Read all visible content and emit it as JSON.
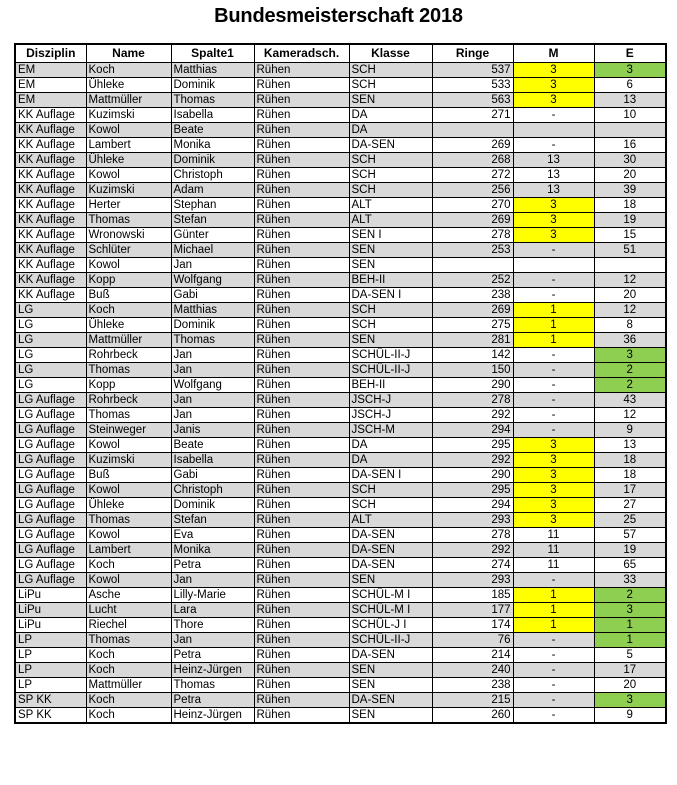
{
  "page": {
    "title": "Bundesmeisterschaft 2018",
    "colors": {
      "shaded_row": "#d9d9d9",
      "plain_row": "#ffffff",
      "highlight_yellow": "#ffff00",
      "highlight_green": "#8ece51",
      "border": "#000000",
      "text": "#000000"
    }
  },
  "table": {
    "columns": [
      "Disziplin",
      "Name",
      "Spalte1",
      "Kameradsch.",
      "Klasse",
      "Ringe",
      "M",
      "E"
    ],
    "rows": [
      {
        "disziplin": "EM",
        "name": "Koch",
        "spalte1": "Matthias",
        "kameradsch": "Rühen",
        "klasse": "SCH",
        "ringe": "537",
        "m": "3",
        "e": "3",
        "shaded": true,
        "m_hl": "yellow",
        "e_hl": "green"
      },
      {
        "disziplin": "EM",
        "name": "Ühleke",
        "spalte1": "Dominik",
        "kameradsch": "Rühen",
        "klasse": "SCH",
        "ringe": "533",
        "m": "3",
        "e": "6",
        "shaded": false,
        "m_hl": "yellow",
        "e_hl": ""
      },
      {
        "disziplin": "EM",
        "name": "Mattmüller",
        "spalte1": "Thomas",
        "kameradsch": "Rühen",
        "klasse": "SEN",
        "ringe": "563",
        "m": "3",
        "e": "13",
        "shaded": true,
        "m_hl": "yellow",
        "e_hl": ""
      },
      {
        "disziplin": "KK Auflage",
        "name": "Kuzimski",
        "spalte1": "Isabella",
        "kameradsch": "Rühen",
        "klasse": "DA",
        "ringe": "271",
        "m": "-",
        "e": "10",
        "shaded": false,
        "m_hl": "",
        "e_hl": ""
      },
      {
        "disziplin": "KK Auflage",
        "name": "Kowol",
        "spalte1": "Beate",
        "kameradsch": "Rühen",
        "klasse": "DA",
        "ringe": "",
        "m": "",
        "e": "",
        "shaded": true,
        "m_hl": "",
        "e_hl": ""
      },
      {
        "disziplin": "KK Auflage",
        "name": "Lambert",
        "spalte1": "Monika",
        "kameradsch": "Rühen",
        "klasse": "DA-SEN",
        "ringe": "269",
        "m": "-",
        "e": "16",
        "shaded": false,
        "m_hl": "",
        "e_hl": ""
      },
      {
        "disziplin": "KK Auflage",
        "name": "Ühleke",
        "spalte1": "Dominik",
        "kameradsch": "Rühen",
        "klasse": "SCH",
        "ringe": "268",
        "m": "13",
        "e": "30",
        "shaded": true,
        "m_hl": "",
        "e_hl": ""
      },
      {
        "disziplin": "KK Auflage",
        "name": "Kowol",
        "spalte1": "Christoph",
        "kameradsch": "Rühen",
        "klasse": "SCH",
        "ringe": "272",
        "m": "13",
        "e": "20",
        "shaded": false,
        "m_hl": "",
        "e_hl": ""
      },
      {
        "disziplin": "KK Auflage",
        "name": "Kuzimski",
        "spalte1": "Adam",
        "kameradsch": "Rühen",
        "klasse": "SCH",
        "ringe": "256",
        "m": "13",
        "e": "39",
        "shaded": true,
        "m_hl": "",
        "e_hl": ""
      },
      {
        "disziplin": "KK Auflage",
        "name": "Herter",
        "spalte1": "Stephan",
        "kameradsch": "Rühen",
        "klasse": "ALT",
        "ringe": "270",
        "m": "3",
        "e": "18",
        "shaded": false,
        "m_hl": "yellow",
        "e_hl": ""
      },
      {
        "disziplin": "KK Auflage",
        "name": "Thomas",
        "spalte1": "Stefan",
        "kameradsch": "Rühen",
        "klasse": "ALT",
        "ringe": "269",
        "m": "3",
        "e": "19",
        "shaded": true,
        "m_hl": "yellow",
        "e_hl": ""
      },
      {
        "disziplin": "KK Auflage",
        "name": "Wronowski",
        "spalte1": "Günter",
        "kameradsch": "Rühen",
        "klasse": "SEN I",
        "ringe": "278",
        "m": "3",
        "e": "15",
        "shaded": false,
        "m_hl": "yellow",
        "e_hl": ""
      },
      {
        "disziplin": "KK Auflage",
        "name": "Schlüter",
        "spalte1": "Michael",
        "kameradsch": "Rühen",
        "klasse": "SEN",
        "ringe": "253",
        "m": "-",
        "e": "51",
        "shaded": true,
        "m_hl": "",
        "e_hl": ""
      },
      {
        "disziplin": "KK Auflage",
        "name": "Kowol",
        "spalte1": "Jan",
        "kameradsch": "Rühen",
        "klasse": "SEN",
        "ringe": "",
        "m": "",
        "e": "",
        "shaded": false,
        "m_hl": "",
        "e_hl": ""
      },
      {
        "disziplin": "KK Auflage",
        "name": "Kopp",
        "spalte1": "Wolfgang",
        "kameradsch": "Rühen",
        "klasse": "BEH-II",
        "ringe": "252",
        "m": "-",
        "e": "12",
        "shaded": true,
        "m_hl": "",
        "e_hl": ""
      },
      {
        "disziplin": "KK Auflage",
        "name": "Buß",
        "spalte1": "Gabi",
        "kameradsch": "Rühen",
        "klasse": "DA-SEN I",
        "ringe": "238",
        "m": "-",
        "e": "20",
        "shaded": false,
        "m_hl": "",
        "e_hl": ""
      },
      {
        "disziplin": "LG",
        "name": "Koch",
        "spalte1": "Matthias",
        "kameradsch": "Rühen",
        "klasse": "SCH",
        "ringe": "269",
        "m": "1",
        "e": "12",
        "shaded": true,
        "m_hl": "yellow",
        "e_hl": ""
      },
      {
        "disziplin": "LG",
        "name": "Ühleke",
        "spalte1": "Dominik",
        "kameradsch": "Rühen",
        "klasse": "SCH",
        "ringe": "275",
        "m": "1",
        "e": "8",
        "shaded": false,
        "m_hl": "yellow",
        "e_hl": ""
      },
      {
        "disziplin": "LG",
        "name": "Mattmüller",
        "spalte1": "Thomas",
        "kameradsch": "Rühen",
        "klasse": "SEN",
        "ringe": "281",
        "m": "1",
        "e": "36",
        "shaded": true,
        "m_hl": "yellow",
        "e_hl": ""
      },
      {
        "disziplin": "LG",
        "name": "Rohrbeck",
        "spalte1": "Jan",
        "kameradsch": "Rühen",
        "klasse": "SCHÜL-II-J",
        "ringe": "142",
        "m": "-",
        "e": "3",
        "shaded": false,
        "m_hl": "",
        "e_hl": "green"
      },
      {
        "disziplin": "LG",
        "name": "Thomas",
        "spalte1": "Jan",
        "kameradsch": "Rühen",
        "klasse": "SCHÜL-II-J",
        "ringe": "150",
        "m": "-",
        "e": "2",
        "shaded": true,
        "m_hl": "",
        "e_hl": "green"
      },
      {
        "disziplin": "LG",
        "name": "Kopp",
        "spalte1": "Wolfgang",
        "kameradsch": "Rühen",
        "klasse": "BEH-II",
        "ringe": "290",
        "m": "-",
        "e": "2",
        "shaded": false,
        "m_hl": "",
        "e_hl": "green"
      },
      {
        "disziplin": "LG Auflage",
        "name": "Rohrbeck",
        "spalte1": "Jan",
        "kameradsch": "Rühen",
        "klasse": "JSCH-J",
        "ringe": "278",
        "m": "-",
        "e": "43",
        "shaded": true,
        "m_hl": "",
        "e_hl": ""
      },
      {
        "disziplin": "LG Auflage",
        "name": "Thomas",
        "spalte1": "Jan",
        "kameradsch": "Rühen",
        "klasse": "JSCH-J",
        "ringe": "292",
        "m": "-",
        "e": "12",
        "shaded": false,
        "m_hl": "",
        "e_hl": ""
      },
      {
        "disziplin": "LG Auflage",
        "name": "Steinweger",
        "spalte1": "Janis",
        "kameradsch": "Rühen",
        "klasse": "JSCH-M",
        "ringe": "294",
        "m": "-",
        "e": "9",
        "shaded": true,
        "m_hl": "",
        "e_hl": ""
      },
      {
        "disziplin": "LG Auflage",
        "name": "Kowol",
        "spalte1": "Beate",
        "kameradsch": "Rühen",
        "klasse": "DA",
        "ringe": "295",
        "m": "3",
        "e": "13",
        "shaded": false,
        "m_hl": "yellow",
        "e_hl": ""
      },
      {
        "disziplin": "LG Auflage",
        "name": "Kuzimski",
        "spalte1": "Isabella",
        "kameradsch": "Rühen",
        "klasse": "DA",
        "ringe": "292",
        "m": "3",
        "e": "18",
        "shaded": true,
        "m_hl": "yellow",
        "e_hl": ""
      },
      {
        "disziplin": "LG Auflage",
        "name": "Buß",
        "spalte1": "Gabi",
        "kameradsch": "Rühen",
        "klasse": "DA-SEN I",
        "ringe": "290",
        "m": "3",
        "e": "18",
        "shaded": false,
        "m_hl": "yellow",
        "e_hl": ""
      },
      {
        "disziplin": "LG Auflage",
        "name": "Kowol",
        "spalte1": "Christoph",
        "kameradsch": "Rühen",
        "klasse": "SCH",
        "ringe": "295",
        "m": "3",
        "e": "17",
        "shaded": true,
        "m_hl": "yellow",
        "e_hl": ""
      },
      {
        "disziplin": "LG Auflage",
        "name": "Ühleke",
        "spalte1": "Dominik",
        "kameradsch": "Rühen",
        "klasse": "SCH",
        "ringe": "294",
        "m": "3",
        "e": "27",
        "shaded": false,
        "m_hl": "yellow",
        "e_hl": ""
      },
      {
        "disziplin": "LG Auflage",
        "name": "Thomas",
        "spalte1": "Stefan",
        "kameradsch": "Rühen",
        "klasse": "ALT",
        "ringe": "293",
        "m": "3",
        "e": "25",
        "shaded": true,
        "m_hl": "yellow",
        "e_hl": ""
      },
      {
        "disziplin": "LG Auflage",
        "name": "Kowol",
        "spalte1": "Eva",
        "kameradsch": "Rühen",
        "klasse": "DA-SEN",
        "ringe": "278",
        "m": "11",
        "e": "57",
        "shaded": false,
        "m_hl": "",
        "e_hl": ""
      },
      {
        "disziplin": "LG Auflage",
        "name": "Lambert",
        "spalte1": "Monika",
        "kameradsch": "Rühen",
        "klasse": "DA-SEN",
        "ringe": "292",
        "m": "11",
        "e": "19",
        "shaded": true,
        "m_hl": "",
        "e_hl": ""
      },
      {
        "disziplin": "LG Auflage",
        "name": "Koch",
        "spalte1": "Petra",
        "kameradsch": "Rühen",
        "klasse": "DA-SEN",
        "ringe": "274",
        "m": "11",
        "e": "65",
        "shaded": false,
        "m_hl": "",
        "e_hl": ""
      },
      {
        "disziplin": "LG Auflage",
        "name": "Kowol",
        "spalte1": "Jan",
        "kameradsch": "Rühen",
        "klasse": "SEN",
        "ringe": "293",
        "m": "-",
        "e": "33",
        "shaded": true,
        "m_hl": "",
        "e_hl": ""
      },
      {
        "disziplin": "LiPu",
        "name": "Asche",
        "spalte1": "Lilly-Marie",
        "kameradsch": "Rühen",
        "klasse": "SCHÜL-M I",
        "ringe": "185",
        "m": "1",
        "e": "2",
        "shaded": false,
        "m_hl": "yellow",
        "e_hl": "green"
      },
      {
        "disziplin": "LiPu",
        "name": "Lucht",
        "spalte1": "Lara",
        "kameradsch": "Rühen",
        "klasse": "SCHÜL-M I",
        "ringe": "177",
        "m": "1",
        "e": "3",
        "shaded": true,
        "m_hl": "yellow",
        "e_hl": "green"
      },
      {
        "disziplin": "LiPu",
        "name": "Riechel",
        "spalte1": "Thore",
        "kameradsch": "Rühen",
        "klasse": "SCHÜL-J I",
        "ringe": "174",
        "m": "1",
        "e": "1",
        "shaded": false,
        "m_hl": "yellow",
        "e_hl": "green"
      },
      {
        "disziplin": "LP",
        "name": "Thomas",
        "spalte1": "Jan",
        "kameradsch": "Rühen",
        "klasse": "SCHÜL-II-J",
        "ringe": "76",
        "m": "-",
        "e": "1",
        "shaded": true,
        "m_hl": "",
        "e_hl": "green"
      },
      {
        "disziplin": "LP",
        "name": "Koch",
        "spalte1": "Petra",
        "kameradsch": "Rühen",
        "klasse": "DA-SEN",
        "ringe": "214",
        "m": "-",
        "e": "5",
        "shaded": false,
        "m_hl": "",
        "e_hl": ""
      },
      {
        "disziplin": "LP",
        "name": "Koch",
        "spalte1": "Heinz-Jürgen",
        "kameradsch": "Rühen",
        "klasse": "SEN",
        "ringe": "240",
        "m": "-",
        "e": "17",
        "shaded": true,
        "m_hl": "",
        "e_hl": ""
      },
      {
        "disziplin": "LP",
        "name": "Mattmüller",
        "spalte1": "Thomas",
        "kameradsch": "Rühen",
        "klasse": "SEN",
        "ringe": "238",
        "m": "-",
        "e": "20",
        "shaded": false,
        "m_hl": "",
        "e_hl": ""
      },
      {
        "disziplin": "SP KK",
        "name": "Koch",
        "spalte1": "Petra",
        "kameradsch": "Rühen",
        "klasse": "DA-SEN",
        "ringe": "215",
        "m": "-",
        "e": "3",
        "shaded": true,
        "m_hl": "",
        "e_hl": "green"
      },
      {
        "disziplin": "SP KK",
        "name": "Koch",
        "spalte1": "Heinz-Jürgen",
        "kameradsch": "Rühen",
        "klasse": "SEN",
        "ringe": "260",
        "m": "-",
        "e": "9",
        "shaded": false,
        "m_hl": "",
        "e_hl": ""
      }
    ]
  }
}
